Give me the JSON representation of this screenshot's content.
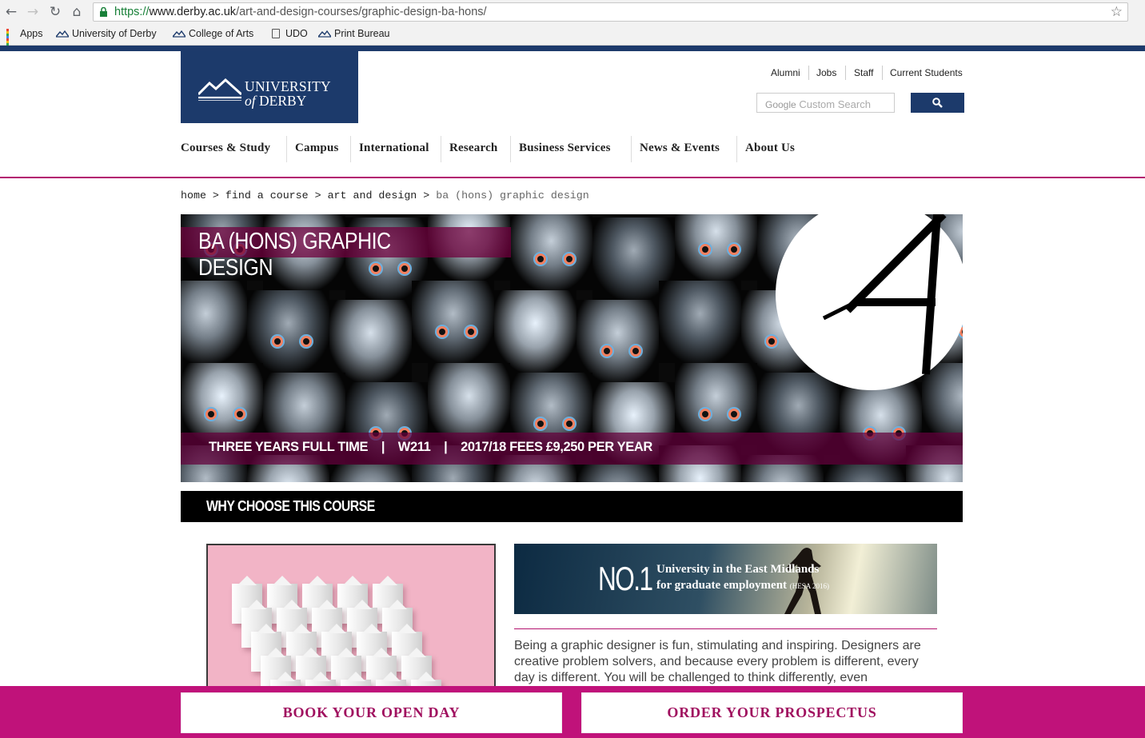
{
  "browser": {
    "url_scheme": "https://",
    "url_host": "www.derby.ac.uk",
    "url_path": "/art-and-design-courses/graphic-design-ba-hons/",
    "bookmarks": [
      "Apps",
      "University of Derby",
      "College of Arts",
      "UDO",
      "Print Bureau"
    ]
  },
  "site": {
    "logo_line1": "UNIVERSITY",
    "logo_of": "of",
    "logo_line2": "DERBY",
    "utility_links": [
      "Alumni",
      "Jobs",
      "Staff",
      "Current Students"
    ],
    "search_google": "Google",
    "search_placeholder": "Custom Search",
    "nav": [
      "Courses & Study",
      "Campus",
      "International",
      "Research",
      "Business Services",
      "News & Events",
      "About Us"
    ],
    "brand_colors": {
      "navy": "#1c3a6b",
      "magenta": "#c0127a"
    }
  },
  "breadcrumb": {
    "items": [
      "home",
      "find a course",
      "art and design"
    ],
    "current": "ba (hons) graphic design",
    "separator": ">"
  },
  "hero": {
    "title": "BA (HONS) GRAPHIC DESIGN",
    "meta": "THREE YEARS FULL TIME    |    W211    |    2017/18 FEES £9,250 PER YEAR"
  },
  "section": {
    "why_title": "WHY CHOOSE THIS COURSE"
  },
  "banner": {
    "big": "NO.1",
    "line1": "University in the East Midlands",
    "line2": "for graduate employment",
    "source": "(HESA 2016)"
  },
  "body": {
    "paragraph": "Being a graphic designer is fun, stimulating and inspiring. Designers are creative problem solvers, and because every problem is different, every day is different. You will be challenged to think differently, even"
  },
  "cta": {
    "open_day": "BOOK YOUR OPEN DAY",
    "prospectus": "ORDER YOUR PROSPECTUS"
  }
}
